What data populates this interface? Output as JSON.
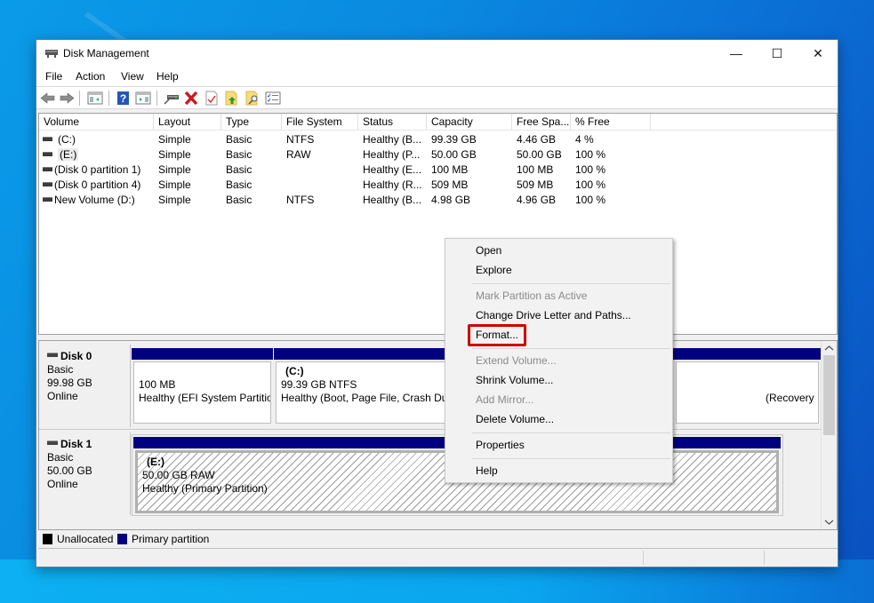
{
  "window": {
    "title": "Disk Management",
    "controls": {
      "minimize": "—",
      "maximize": "☐",
      "close": "✕"
    }
  },
  "menubar": [
    "File",
    "Action",
    "View",
    "Help"
  ],
  "toolbar": {
    "icons": [
      "back-icon",
      "forward-icon",
      "show-hide-console-tree-icon",
      "help-icon",
      "show-hide-action-pane-icon",
      "connect-disk-icon",
      "delete-icon",
      "check-icon",
      "folder-up-icon",
      "folder-search-icon",
      "properties-list-icon"
    ]
  },
  "volume_list": {
    "columns": [
      "Volume",
      "Layout",
      "Type",
      "File System",
      "Status",
      "Capacity",
      "Free Spa...",
      "% Free"
    ],
    "rows": [
      {
        "volume": "(C:)",
        "layout": "Simple",
        "type": "Basic",
        "fs": "NTFS",
        "status": "Healthy (B...",
        "capacity": "99.39 GB",
        "free": "4.46 GB",
        "pct": "4 %"
      },
      {
        "volume": "(E:)",
        "layout": "Simple",
        "type": "Basic",
        "fs": "RAW",
        "status": "Healthy (P...",
        "capacity": "50.00 GB",
        "free": "50.00 GB",
        "pct": "100 %"
      },
      {
        "volume": "(Disk 0 partition 1)",
        "layout": "Simple",
        "type": "Basic",
        "fs": "",
        "status": "Healthy (E...",
        "capacity": "100 MB",
        "free": "100 MB",
        "pct": "100 %"
      },
      {
        "volume": "(Disk 0 partition 4)",
        "layout": "Simple",
        "type": "Basic",
        "fs": "",
        "status": "Healthy (R...",
        "capacity": "509 MB",
        "free": "509 MB",
        "pct": "100 %"
      },
      {
        "volume": "New Volume (D:)",
        "layout": "Simple",
        "type": "Basic",
        "fs": "NTFS",
        "status": "Healthy (B...",
        "capacity": "4.98 GB",
        "free": "4.96 GB",
        "pct": "100 %"
      }
    ]
  },
  "disks": [
    {
      "name": "Disk 0",
      "type": "Basic",
      "size": "99.98 GB",
      "state": "Online",
      "partitions": [
        {
          "label": "",
          "line1": "100 MB",
          "line2": "Healthy (EFI System Partitio"
        },
        {
          "label": "(C:)",
          "line1": "99.39 GB NTFS",
          "line2": "Healthy (Boot, Page File, Crash Dun"
        },
        {
          "label": "",
          "line1": "",
          "line2": "(Recovery Partition)"
        }
      ]
    },
    {
      "name": "Disk 1",
      "type": "Basic",
      "size": "50.00 GB",
      "state": "Online",
      "partitions": [
        {
          "label": "(E:)",
          "line1": "50.00 GB RAW",
          "line2": "Healthy (Primary Partition)"
        }
      ]
    }
  ],
  "legend": [
    {
      "label": "Unallocated",
      "color": "#000000"
    },
    {
      "label": "Primary partition",
      "color": "#000080"
    }
  ],
  "context_menu": {
    "items": [
      {
        "label": "Open",
        "enabled": true
      },
      {
        "label": "Explore",
        "enabled": true
      },
      {
        "label": "Mark Partition as Active",
        "enabled": false
      },
      {
        "label": "Change Drive Letter and Paths...",
        "enabled": true
      },
      {
        "label": "Format...",
        "enabled": true,
        "highlighted": true
      },
      {
        "label": "Extend Volume...",
        "enabled": false
      },
      {
        "label": "Shrink Volume...",
        "enabled": true
      },
      {
        "label": "Add Mirror...",
        "enabled": false
      },
      {
        "label": "Delete Volume...",
        "enabled": true
      },
      {
        "label": "Properties",
        "enabled": true
      },
      {
        "label": "Help",
        "enabled": true
      }
    ],
    "highlight_color": "#cc0000"
  }
}
